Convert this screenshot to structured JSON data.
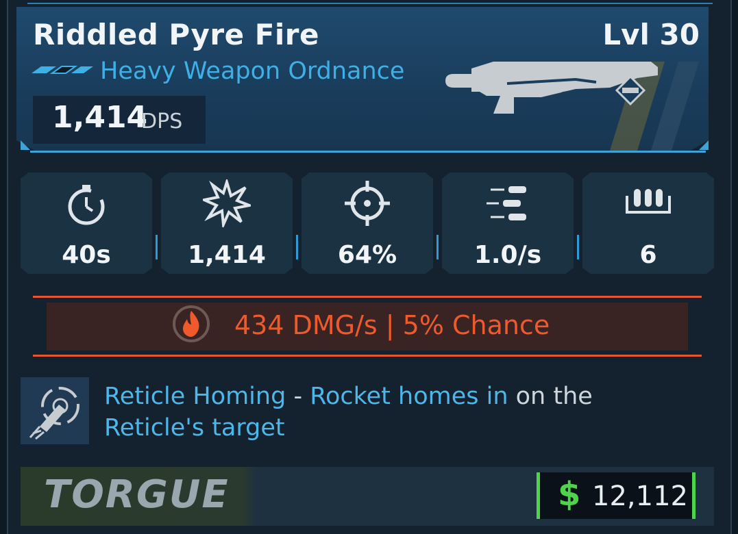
{
  "item": {
    "name": "Riddled Pyre Fire",
    "level": "Lvl 30",
    "weapon_type": "Heavy Weapon Ordnance",
    "dps_value": "1,414",
    "dps_label": "DPS",
    "rarity_icon": "rarity-chevrons-icon",
    "weapon_image": "rocket-launcher-icon"
  },
  "stats": [
    {
      "icon": "stopwatch-icon",
      "value": "40s"
    },
    {
      "icon": "damage-burst-icon",
      "value": "1,414"
    },
    {
      "icon": "crosshair-icon",
      "value": "64%"
    },
    {
      "icon": "fire-rate-icon",
      "value": "1.0/s"
    },
    {
      "icon": "magazine-icon",
      "value": "6"
    }
  ],
  "element": {
    "icon": "fire-element-icon",
    "text": "434 DMG/s | 5% Chance",
    "color": "#ef5a2c"
  },
  "perk": {
    "icon": "homing-rocket-icon",
    "name": "Reticle Homing",
    "dash": " - ",
    "desc_highlight": "Rocket homes in",
    "desc_rest": " on the ",
    "desc_highlight2": "Reticle's target"
  },
  "footer": {
    "manufacturer": "TORGUE",
    "currency_symbol": "$",
    "price": "12,112"
  },
  "colors": {
    "accent_blue": "#3fb0e6",
    "fire": "#ef5a2c",
    "money": "#4fd34a"
  }
}
